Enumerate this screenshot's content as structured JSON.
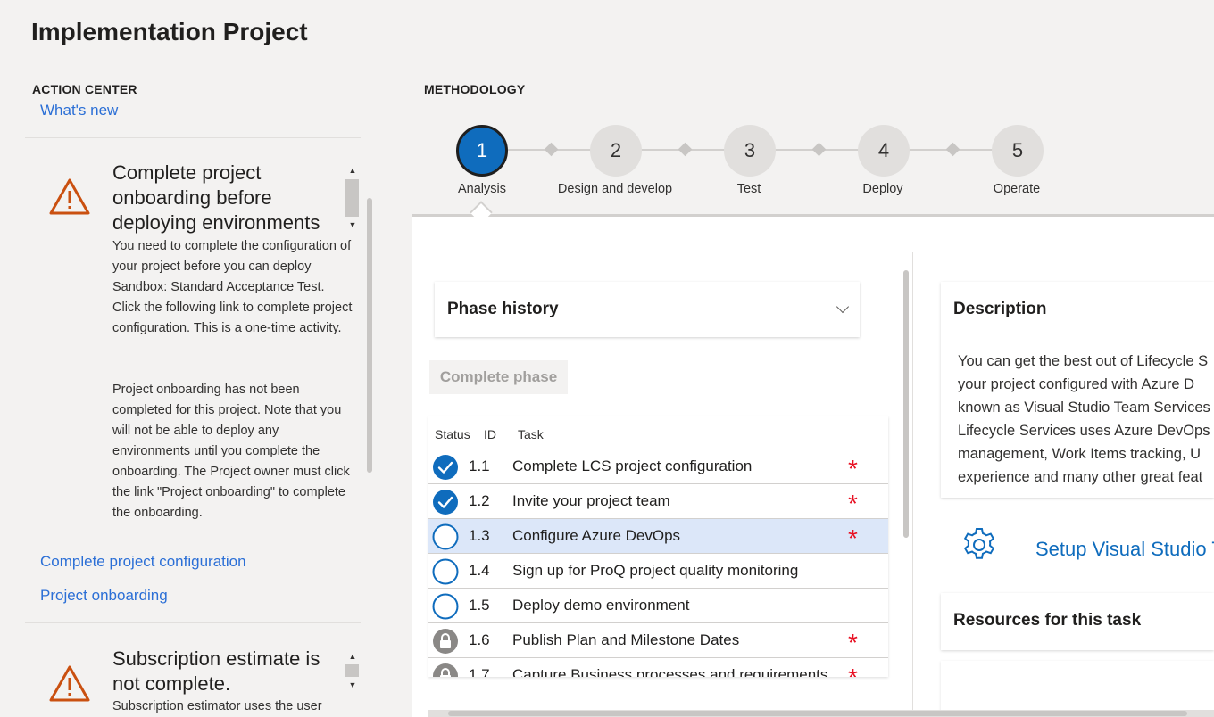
{
  "page": {
    "title": "Implementation Project"
  },
  "action_center": {
    "label": "ACTION CENTER",
    "whats_new": "What's new",
    "cards": [
      {
        "title": "Complete project onboarding before deploying environments",
        "body_p1": "You need to complete the configuration of your project before you can deploy Sandbox: Standard Acceptance Test. Click the following link to complete project configuration. This is a one-time activity.",
        "body_p2": "Project onboarding has not been completed for this project. Note that you will not be able to deploy any environments until you complete the onboarding. The Project owner must click the link \"Project onboarding\" to complete the onboarding.",
        "links": [
          "Complete project configuration",
          "Project onboarding"
        ]
      },
      {
        "title": "Subscription estimate is not complete.",
        "body_p1": "Subscription estimator uses the user"
      }
    ]
  },
  "methodology": {
    "label": "METHODOLOGY",
    "phases": [
      {
        "number": "1",
        "label": "Analysis",
        "active": true
      },
      {
        "number": "2",
        "label": "Design and develop",
        "active": false
      },
      {
        "number": "3",
        "label": "Test",
        "active": false
      },
      {
        "number": "4",
        "label": "Deploy",
        "active": false
      },
      {
        "number": "5",
        "label": "Operate",
        "active": false
      }
    ]
  },
  "phase_history": {
    "label": "Phase history"
  },
  "complete_phase": "Complete phase",
  "task_table": {
    "headers": {
      "status": "Status",
      "id": "ID",
      "task": "Task"
    },
    "rows": [
      {
        "status": "done",
        "id": "1.1",
        "task": "Complete LCS project configuration",
        "required": true
      },
      {
        "status": "done",
        "id": "1.2",
        "task": "Invite your project team",
        "required": true
      },
      {
        "status": "open",
        "id": "1.3",
        "task": "Configure Azure DevOps",
        "required": true,
        "selected": true
      },
      {
        "status": "open",
        "id": "1.4",
        "task": "Sign up for ProQ project quality monitoring",
        "required": false
      },
      {
        "status": "open",
        "id": "1.5",
        "task": "Deploy demo environment",
        "required": false
      },
      {
        "status": "locked",
        "id": "1.6",
        "task": "Publish Plan and Milestone Dates",
        "required": true
      },
      {
        "status": "locked",
        "id": "1.7",
        "task": "Capture Business processes and requirements",
        "required": true
      }
    ],
    "required_symbol": "*"
  },
  "description": {
    "title": "Description",
    "lines": [
      "You can get the best out of Lifecycle S",
      "your project configured with Azure D",
      "known as Visual Studio Team Services",
      "Lifecycle Services uses Azure DevOps",
      "management, Work Items tracking, U",
      "experience and many other great feat"
    ]
  },
  "setup_link": "Setup Visual Studio T",
  "resources": {
    "title": "Resources for this task"
  },
  "colors": {
    "accent": "#0f6cbd",
    "link": "#2b6fd6",
    "warning": "#ca5010",
    "required": "#e81123",
    "selected_row": "#dce7f9"
  },
  "icons": {
    "warning": "warning-triangle-icon",
    "check": "check-circle-icon",
    "lock": "lock-icon",
    "gear": "gear-icon",
    "chevron": "chevron-down-icon"
  }
}
